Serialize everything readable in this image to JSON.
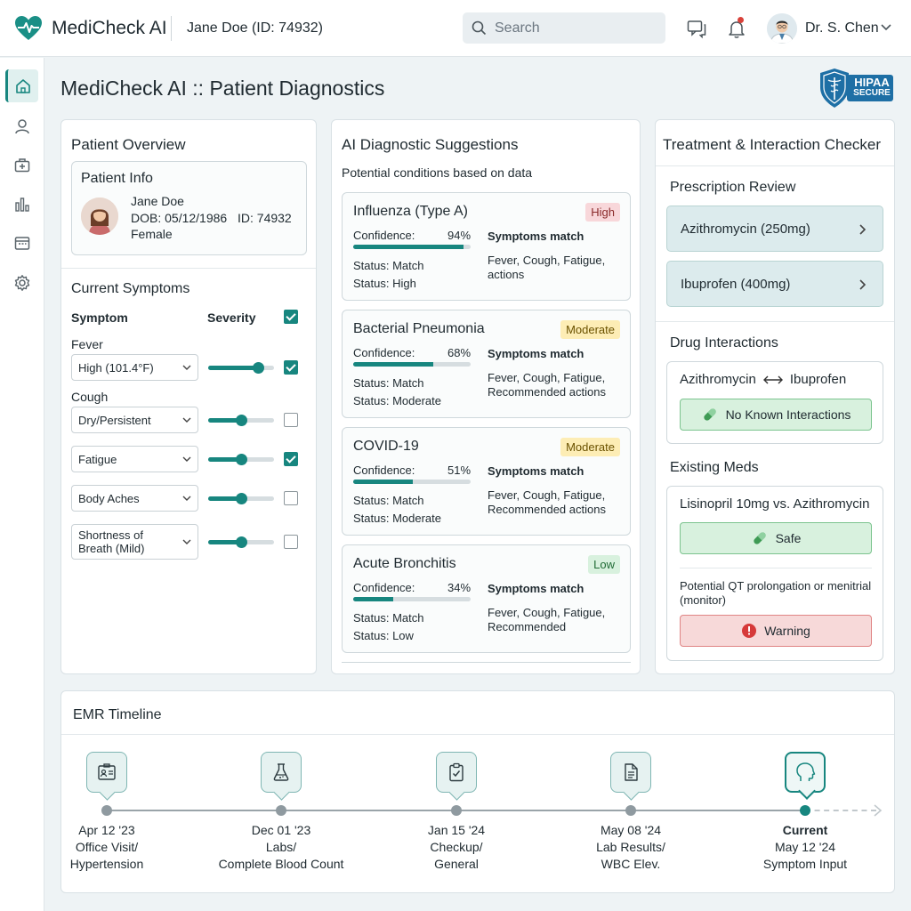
{
  "header": {
    "brand": "MediCheck AI",
    "patient": "Jane Doe (ID: 74932)",
    "search_placeholder": "Search",
    "user": "Dr. S. Chen"
  },
  "sidebar": {
    "items": [
      {
        "icon": "home-icon",
        "active": true
      },
      {
        "icon": "user-icon"
      },
      {
        "icon": "medical-kit-icon"
      },
      {
        "icon": "bar-chart-icon"
      },
      {
        "icon": "calendar-icon"
      },
      {
        "icon": "gear-icon"
      }
    ]
  },
  "page": {
    "title": "MediCheck AI :: Patient Diagnostics",
    "badge_line1": "HIPAA",
    "badge_line2": "SECURE"
  },
  "overview": {
    "title": "Patient Overview",
    "info_title": "Patient Info",
    "name": "Jane Doe",
    "dob": "DOB: 05/12/1986",
    "id": "ID: 74932",
    "sex": "Female",
    "symptoms_title": "Current Symptoms",
    "col_symptom": "Symptom",
    "col_severity": "Severity",
    "symptoms": [
      {
        "label": "Fever",
        "value": "High (101.4°F)",
        "severity": 0.75,
        "checked": true
      },
      {
        "label": "Cough",
        "value": "Dry/Persistent",
        "severity": 0.5,
        "checked": false
      },
      {
        "label": "",
        "value": "Fatigue",
        "severity": 0.5,
        "checked": true
      },
      {
        "label": "",
        "value": "Body Aches",
        "severity": 0.5,
        "checked": false
      },
      {
        "label": "",
        "value": "Shortness of Breath (Mild)",
        "severity": 0.5,
        "checked": false
      }
    ]
  },
  "ai": {
    "title": "AI Diagnostic Suggestions",
    "subtitle": "Potential conditions based on data",
    "items": [
      {
        "name": "Influenza (Type A)",
        "badge": "High",
        "confidence_label": "Confidence:",
        "confidence": "94%",
        "conf": 0.94,
        "status1": "Status: Match",
        "status2": "Status: High",
        "sm_title": "Symptoms match",
        "sm_text": "Fever, Cough, Fatigue, actions"
      },
      {
        "name": "Bacterial Pneumonia",
        "badge": "Moderate",
        "confidence_label": "Confidence:",
        "confidence": "68%",
        "conf": 0.68,
        "status1": "Status: Match",
        "status2": "Status: Moderate",
        "sm_title": "Symptoms match",
        "sm_text": "Fever, Cough, Fatigue, Recommended actions"
      },
      {
        "name": "COVID-19",
        "badge": "Moderate",
        "confidence_label": "Confidence:",
        "confidence": "51%",
        "conf": 0.51,
        "status1": "Status: Match",
        "status2": "Status: Moderate",
        "sm_title": "Symptoms match",
        "sm_text": "Fever, Cough, Fatigue, Recommended actions"
      },
      {
        "name": "Acute Bronchitis",
        "badge": "Low",
        "confidence_label": "Confidence:",
        "confidence": "34%",
        "conf": 0.34,
        "status1": "Status: Match",
        "status2": "Status: Low",
        "sm_title": "Symptoms match",
        "sm_text": "Fever, Cough, Fatigue, Recommended"
      }
    ]
  },
  "treatment": {
    "title": "Treatment & Interaction Checker",
    "rx_title": "Prescription Review",
    "rx": [
      "Azithromycin (250mg)",
      "Ibuprofen (400mg)"
    ],
    "interactions_title": "Drug Interactions",
    "pair_a": "Azithromycin",
    "pair_b": "Ibuprofen",
    "no_interactions": "No Known Interactions",
    "existing_title": "Existing Meds",
    "existing_pair": "Lisinopril 10mg vs. Azithromycin",
    "safe": "Safe",
    "note": "Potential QT prolongation or menitrial (monitor)",
    "warning": "Warning"
  },
  "timeline": {
    "title": "EMR Timeline",
    "events": [
      {
        "date": "Apr 12 '23",
        "l1": "Office Visit/",
        "l2": "Hypertension",
        "icon": "id-card-icon"
      },
      {
        "date": "Dec 01 '23",
        "l1": "Labs/",
        "l2": "Complete Blood Count",
        "icon": "flask-icon"
      },
      {
        "date": "Jan 15 '24",
        "l1": "Checkup/",
        "l2": "General",
        "icon": "clipboard-check-icon"
      },
      {
        "date": "May 08 '24",
        "l1": "Lab Results/",
        "l2": "WBC Elev.",
        "icon": "document-icon"
      },
      {
        "date": "Current",
        "l1": "May 12 '24",
        "l2": "Symptom Input",
        "icon": "head-profile-icon"
      }
    ]
  },
  "colors": {
    "accent": "#17867f",
    "high": "#f8d7da",
    "moderate": "#fdedb5",
    "low": "#d8f1de"
  }
}
